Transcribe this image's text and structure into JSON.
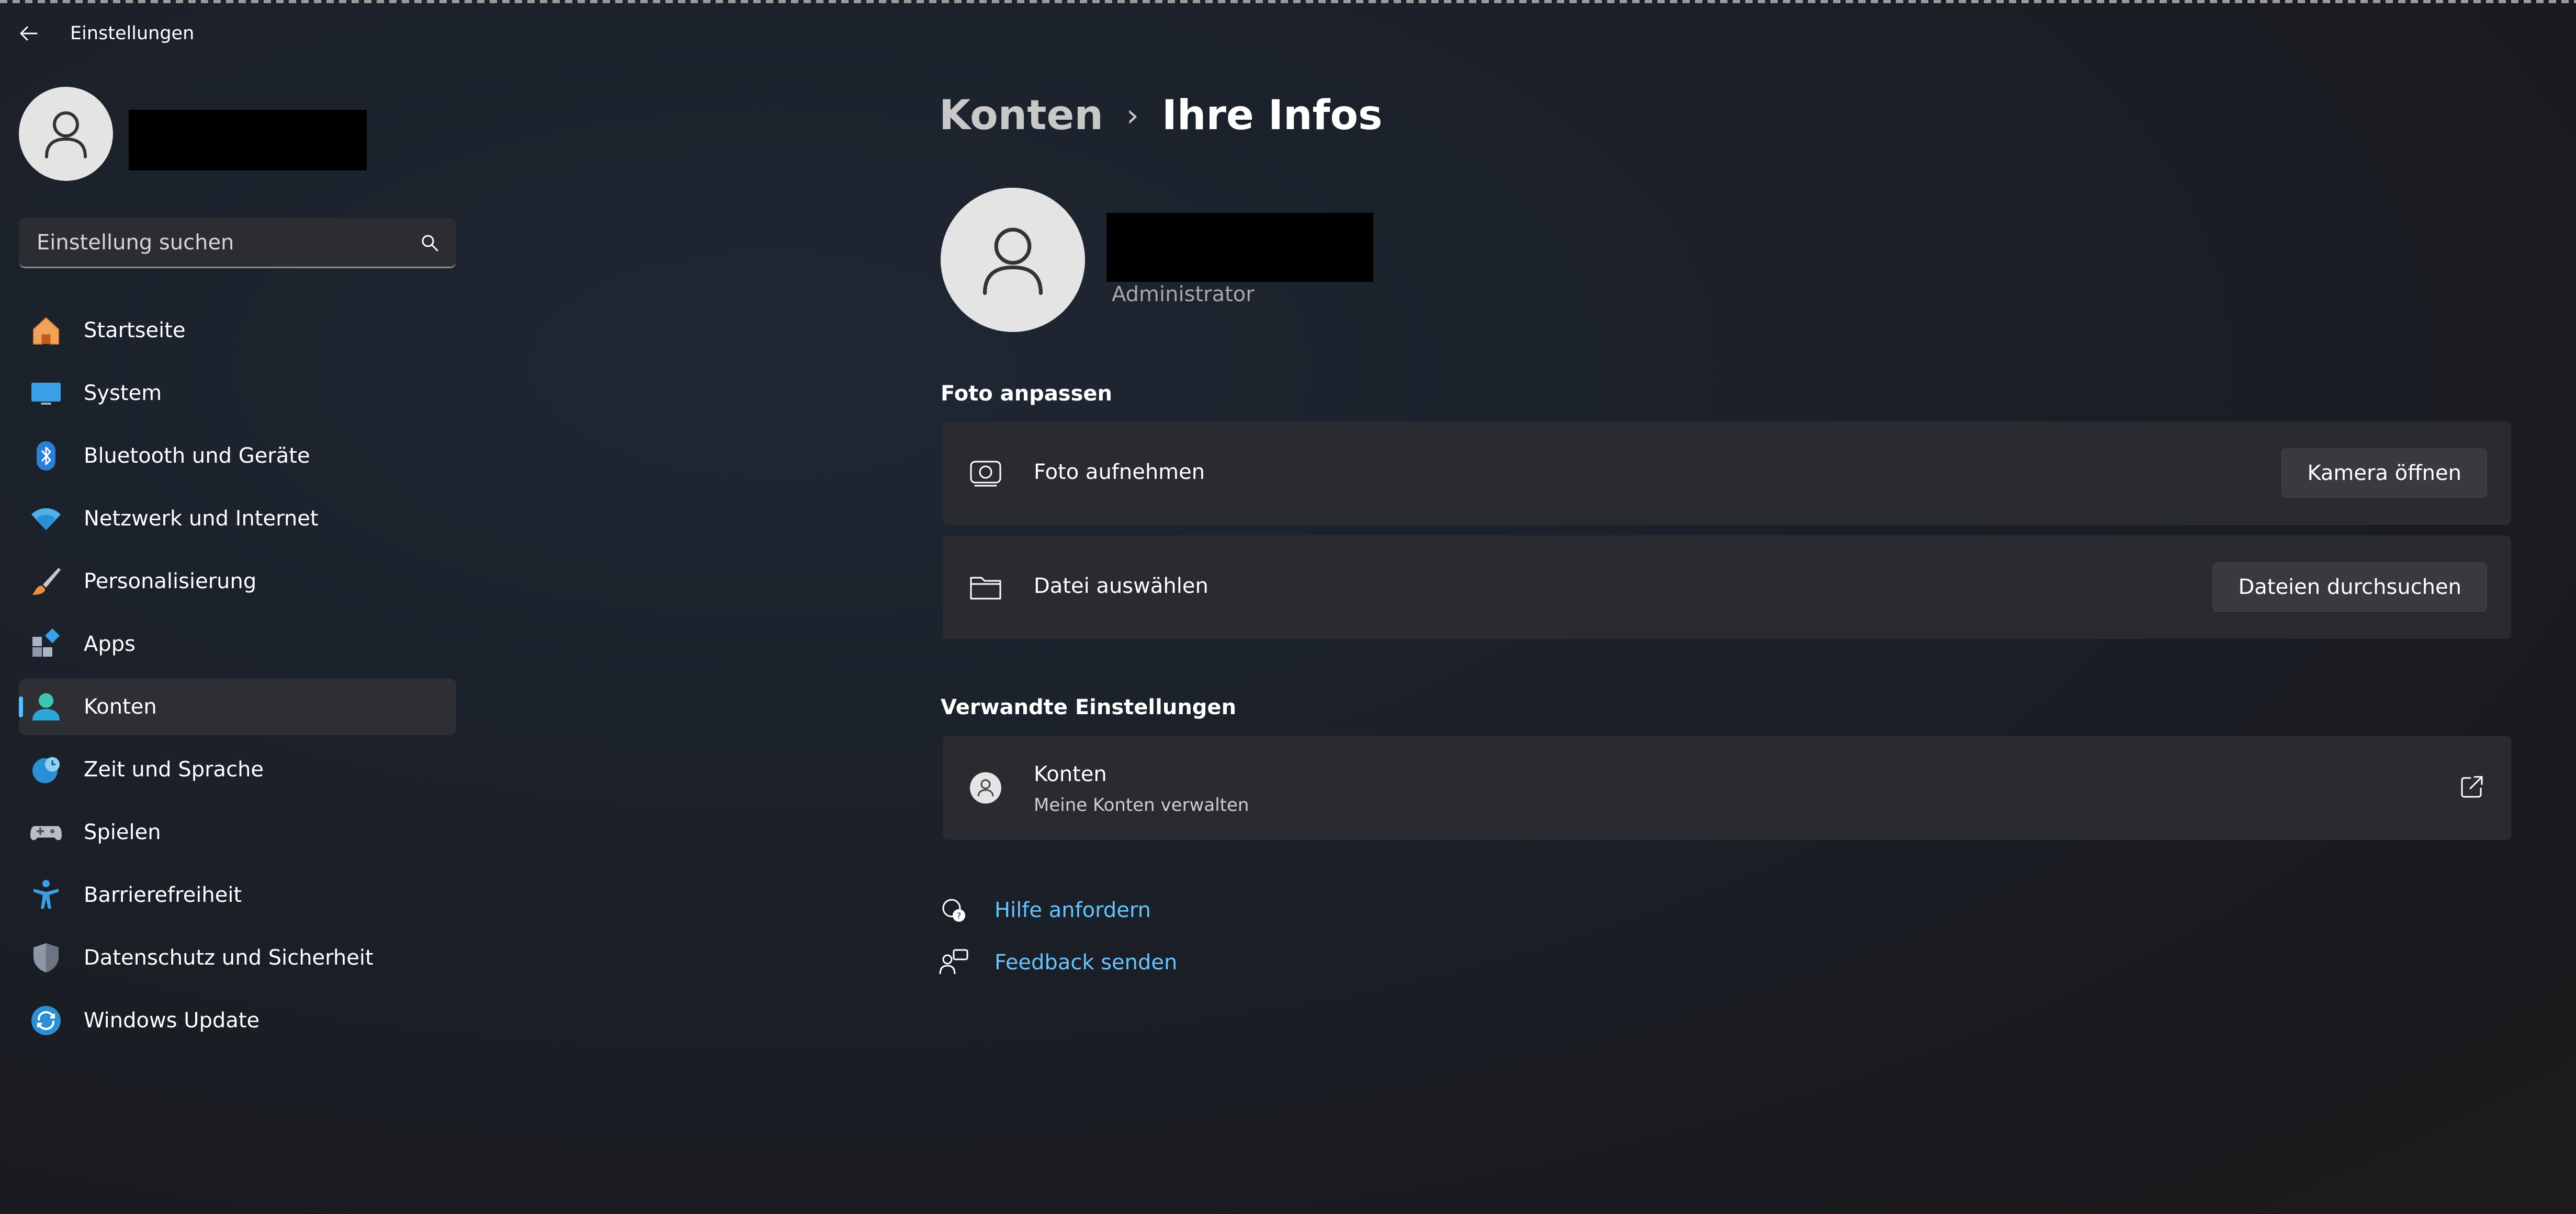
{
  "window": {
    "title": "Einstellungen"
  },
  "search": {
    "placeholder": "Einstellung suchen"
  },
  "sidebar": {
    "items": [
      {
        "label": "Startseite",
        "icon": "home-icon"
      },
      {
        "label": "System",
        "icon": "monitor-icon"
      },
      {
        "label": "Bluetooth und Geräte",
        "icon": "bluetooth-icon"
      },
      {
        "label": "Netzwerk und Internet",
        "icon": "wifi-icon"
      },
      {
        "label": "Personalisierung",
        "icon": "brush-icon"
      },
      {
        "label": "Apps",
        "icon": "apps-icon"
      },
      {
        "label": "Konten",
        "icon": "account-icon",
        "active": true
      },
      {
        "label": "Zeit und Sprache",
        "icon": "globe-clock-icon"
      },
      {
        "label": "Spielen",
        "icon": "gamepad-icon"
      },
      {
        "label": "Barrierefreiheit",
        "icon": "accessibility-icon"
      },
      {
        "label": "Datenschutz und Sicherheit",
        "icon": "shield-icon"
      },
      {
        "label": "Windows Update",
        "icon": "update-icon"
      }
    ]
  },
  "breadcrumb": {
    "parent": "Konten",
    "separator": "›",
    "current": "Ihre Infos"
  },
  "profile": {
    "role": "Administrator"
  },
  "photo_section": {
    "title": "Foto anpassen",
    "take_photo": {
      "label": "Foto aufnehmen",
      "button": "Kamera öffnen"
    },
    "choose_file": {
      "label": "Datei auswählen",
      "button": "Dateien durchsuchen"
    }
  },
  "related": {
    "title": "Verwandte Einstellungen",
    "accounts": {
      "title": "Konten",
      "subtitle": "Meine Konten verwalten"
    }
  },
  "links": {
    "help": "Hilfe anfordern",
    "feedback": "Feedback senden"
  },
  "colors": {
    "accent": "#4cc2ff",
    "link": "#67c3ff",
    "card": "#2a2b30"
  }
}
